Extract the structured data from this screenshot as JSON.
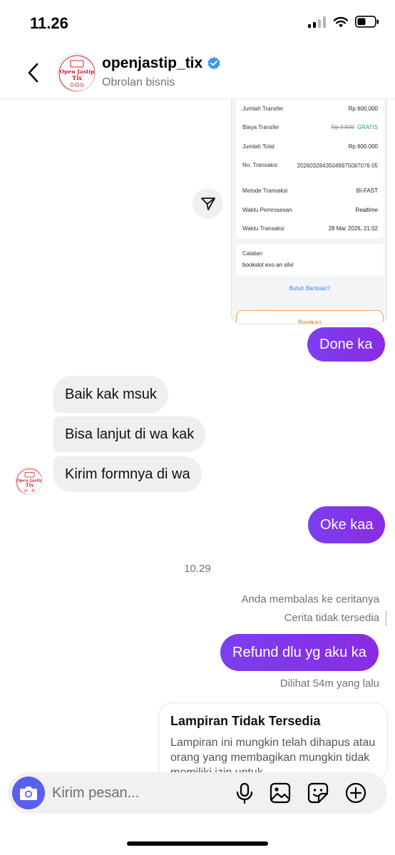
{
  "status_bar": {
    "time": "11.26",
    "icons": [
      "cellular-signal-icon",
      "wifi-icon",
      "battery-icon"
    ]
  },
  "header": {
    "username": "openjastip_tix",
    "subtitle": "Obrolan bisnis",
    "verified": true,
    "avatar_text": [
      "Open Jastip",
      "Tix"
    ]
  },
  "receipt": {
    "rows": [
      {
        "label": "Jumlah Transfer",
        "value": "Rp 600.000"
      },
      {
        "label": "Biaya Transfer",
        "value_strike": "Rp 2.500",
        "value": "GRATIS"
      },
      {
        "label": "Jumlah Total",
        "value": "Rp 600.000"
      },
      {
        "label": "No. Transaksi",
        "value": "20260328435049975087076 05"
      },
      {
        "label": "Metode Transaksi",
        "value": "BI-FAST"
      },
      {
        "label": "Waktu Pemrosesan",
        "value": "Realtime"
      },
      {
        "label": "Waktu Transaksi",
        "value": "28 Mar 2026, 21:02"
      }
    ],
    "note_label": "Catatan",
    "note_text": "bookslot exo an silvi",
    "help_link": "Butuh Bantuan?",
    "share_button": "Bagikan"
  },
  "messages": [
    {
      "from": "me",
      "text": "Done ka"
    },
    {
      "from": "them",
      "text": "Baik kak msuk"
    },
    {
      "from": "them",
      "text": "Bisa lanjut di wa kak"
    },
    {
      "from": "them",
      "text": "Kirim formnya di wa"
    },
    {
      "from": "me",
      "text": "Oke kaa"
    },
    {
      "from": "me",
      "text": "Refund dlu yg aku ka"
    }
  ],
  "timestamp": "10.29",
  "story_reply": {
    "label": "Anda membalas ke ceritanya",
    "status": "Cerita tidak tersedia"
  },
  "seen": "Dilihat 54m yang lalu",
  "attachment": {
    "title": "Lampiran Tidak Tersedia",
    "body": "Lampiran ini mungkin telah dihapus atau orang yang membagikan mungkin tidak memiliki izin untuk"
  },
  "composer": {
    "placeholder": "Kirim pesan...",
    "icons": [
      "camera-icon",
      "microphone-icon",
      "gallery-icon",
      "sticker-icon",
      "add-icon"
    ]
  },
  "colors": {
    "my_bubble": "#7b3ff0",
    "their_bubble": "#efefef",
    "camera_button": "#5b5ff0",
    "verified_badge": "#3797f0",
    "free_text": "#2f9e44"
  }
}
